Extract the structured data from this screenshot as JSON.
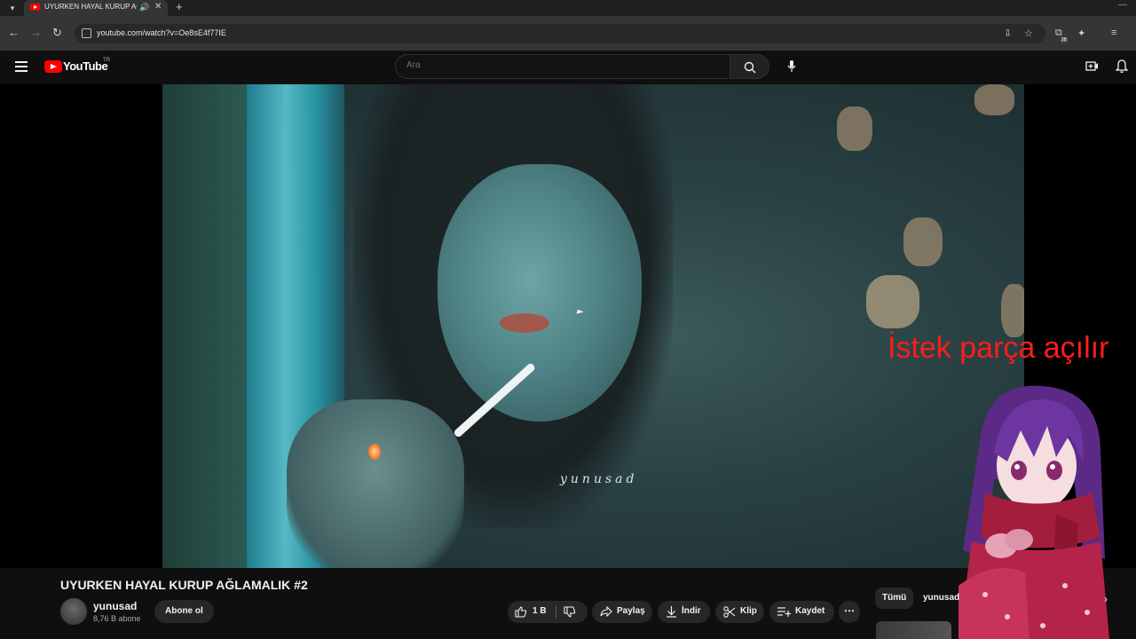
{
  "browser": {
    "tab_title": "UYURKEN HAYAL KURUP AĞLAMALIK #2",
    "new_tab_symbol": "+",
    "url": "youtube.com/watch?v=Oe8sE4f77IE",
    "extension_badge": "28"
  },
  "masthead": {
    "logo_text": "YouTube",
    "country_code": "TR",
    "search_placeholder": "Ara"
  },
  "player": {
    "watermark": "yunusad"
  },
  "overlay": {
    "text": "İstek parça açılır",
    "text_color": "#ff1c1c"
  },
  "video": {
    "title": "UYURKEN HAYAL KURUP AĞLAMALIK #2",
    "channel_name": "yunusad",
    "subscriber_count": "8,76 B abone",
    "subscribe_label": "Abone ol",
    "like_count": "1 B",
    "share_label": "Paylaş",
    "download_label": "İndir",
    "clip_label": "Klip",
    "save_label": "Kaydet"
  },
  "sidebar": {
    "chips": [
      "Tümü",
      "yunusad"
    ]
  },
  "colors": {
    "background": "#0f0f0f",
    "brand_red": "#ff0000",
    "button_bg": "#272727"
  }
}
